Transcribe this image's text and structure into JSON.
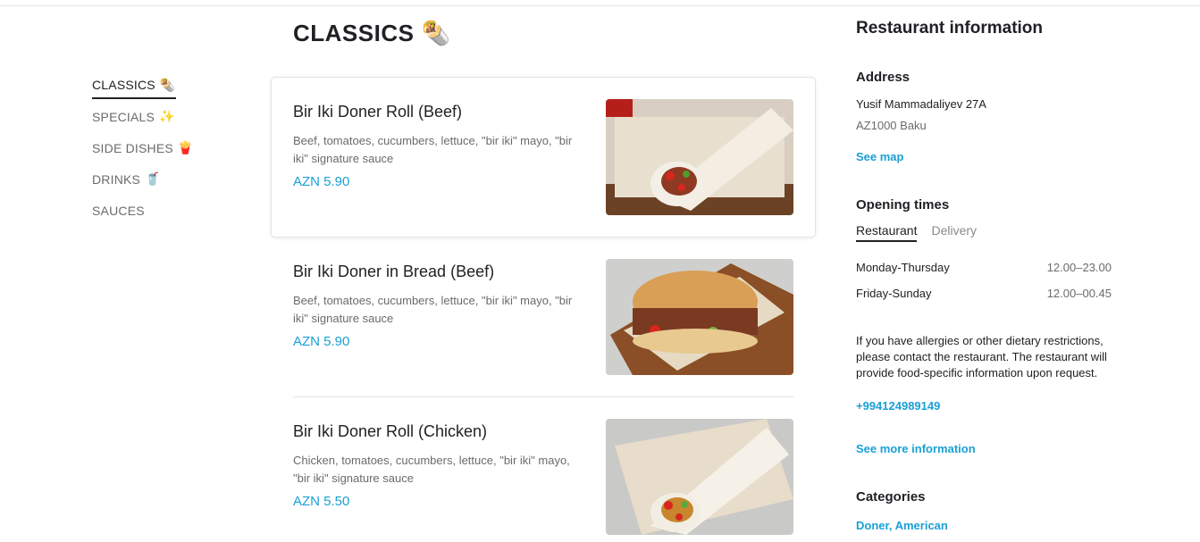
{
  "nav": {
    "items": [
      {
        "label": "CLASSICS",
        "icon": "🌯",
        "active": true
      },
      {
        "label": "SPECIALS",
        "icon": "✨",
        "active": false
      },
      {
        "label": "SIDE DISHES",
        "icon": "🍟",
        "active": false
      },
      {
        "label": "DRINKS",
        "icon": "🥤",
        "active": false
      },
      {
        "label": "SAUCES",
        "icon": "",
        "active": false
      }
    ]
  },
  "section": {
    "title": "CLASSICS",
    "icon": "🌯"
  },
  "menu": {
    "items": [
      {
        "name": "Bir Iki Doner Roll (Beef)",
        "description": "Beef, tomatoes, cucumbers, lettuce, \"bir iki\" mayo, \"bir iki\" signature sauce",
        "price": "AZN 5.90",
        "image": "doner-roll-photo"
      },
      {
        "name": "Bir Iki Doner in Bread (Beef)",
        "description": "Beef, tomatoes, cucumbers, lettuce, \"bir iki\" mayo, \"bir iki\" signature sauce",
        "price": "AZN 5.90",
        "image": "doner-bread-photo"
      },
      {
        "name": "Bir Iki Doner Roll (Chicken)",
        "description": "Chicken, tomatoes, cucumbers, lettuce, \"bir iki\" mayo, \"bir iki\" signature sauce",
        "price": "AZN 5.50",
        "image": "doner-roll-chicken-photo"
      }
    ]
  },
  "info": {
    "title": "Restaurant information",
    "address_heading": "Address",
    "address_line1": "Yusif Mammadaliyev 27A",
    "address_line2": "AZ1000 Baku",
    "see_map": "See map",
    "opening_heading": "Opening times",
    "tabs": [
      {
        "label": "Restaurant",
        "active": true
      },
      {
        "label": "Delivery",
        "active": false
      }
    ],
    "hours": [
      {
        "day": "Monday-Thursday",
        "time": "12.00–23.00"
      },
      {
        "day": "Friday-Sunday",
        "time": "12.00–00.45"
      }
    ],
    "allergy_text": "If you have allergies or other dietary restrictions, please contact the restaurant. The restaurant will provide food-specific information upon request.",
    "phone": "+994124989149",
    "more_info": "See more information",
    "categories_heading": "Categories",
    "categories": [
      "Doner",
      "American"
    ]
  },
  "colors": {
    "accent": "#1aa0d5",
    "text": "#202125",
    "muted": "#6b6b6b"
  }
}
